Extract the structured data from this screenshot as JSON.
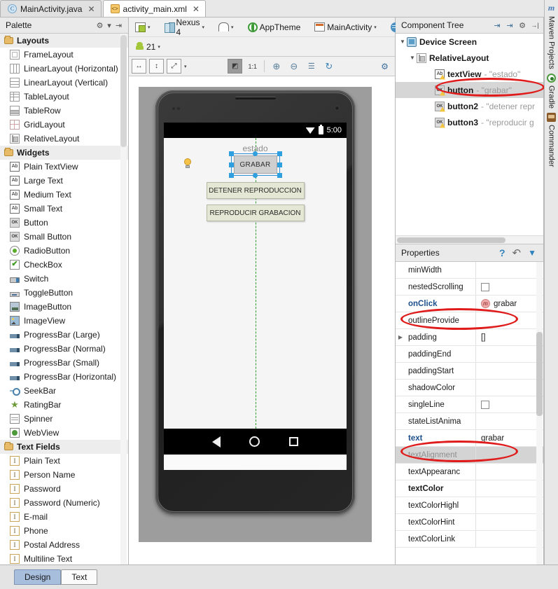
{
  "editor_tabs": [
    {
      "label": "MainActivity.java",
      "icon": "java-class-icon",
      "icon_char": "C",
      "active": false,
      "close": "✕"
    },
    {
      "label": "activity_main.xml",
      "icon": "xml-file-icon",
      "icon_char": "<>",
      "active": true,
      "close": "✕"
    }
  ],
  "palette": {
    "title": "Palette",
    "gear_icon": "⚙",
    "gear_caret": "▾",
    "collapse_icon": "⇥",
    "groups": [
      {
        "label": "Layouts",
        "items": [
          {
            "label": "FrameLayout",
            "icon": "frame-layout-icon"
          },
          {
            "label": "LinearLayout (Horizontal)",
            "icon": "linear-horizontal-icon"
          },
          {
            "label": "LinearLayout (Vertical)",
            "icon": "linear-vertical-icon"
          },
          {
            "label": "TableLayout",
            "icon": "table-layout-icon"
          },
          {
            "label": "TableRow",
            "icon": "table-row-icon"
          },
          {
            "label": "GridLayout",
            "icon": "grid-layout-icon"
          },
          {
            "label": "RelativeLayout",
            "icon": "relative-layout-icon"
          }
        ]
      },
      {
        "label": "Widgets",
        "items": [
          {
            "label": "Plain TextView",
            "icon": "textview-icon",
            "glyph": "Ab"
          },
          {
            "label": "Large Text",
            "icon": "textview-icon",
            "glyph": "Ab"
          },
          {
            "label": "Medium Text",
            "icon": "textview-icon",
            "glyph": "Ab"
          },
          {
            "label": "Small Text",
            "icon": "textview-icon",
            "glyph": "Ab"
          },
          {
            "label": "Button",
            "icon": "button-icon",
            "glyph": "OK"
          },
          {
            "label": "Small Button",
            "icon": "button-icon",
            "glyph": "OK"
          },
          {
            "label": "RadioButton",
            "icon": "radiobutton-icon"
          },
          {
            "label": "CheckBox",
            "icon": "checkbox-icon",
            "glyph": "✔"
          },
          {
            "label": "Switch",
            "icon": "switch-icon"
          },
          {
            "label": "ToggleButton",
            "icon": "togglebutton-icon"
          },
          {
            "label": "ImageButton",
            "icon": "imagebutton-icon"
          },
          {
            "label": "ImageView",
            "icon": "imageview-icon"
          },
          {
            "label": "ProgressBar (Large)",
            "icon": "progressbar-icon"
          },
          {
            "label": "ProgressBar (Normal)",
            "icon": "progressbar-icon"
          },
          {
            "label": "ProgressBar (Small)",
            "icon": "progressbar-icon"
          },
          {
            "label": "ProgressBar (Horizontal)",
            "icon": "progressbar-icon"
          },
          {
            "label": "SeekBar",
            "icon": "seekbar-icon"
          },
          {
            "label": "RatingBar",
            "icon": "ratingbar-icon",
            "glyph": "★"
          },
          {
            "label": "Spinner",
            "icon": "spinner-icon"
          },
          {
            "label": "WebView",
            "icon": "webview-icon"
          }
        ]
      },
      {
        "label": "Text Fields",
        "items": [
          {
            "label": "Plain Text",
            "icon": "textfield-icon",
            "glyph": "I"
          },
          {
            "label": "Person Name",
            "icon": "textfield-icon",
            "glyph": "I"
          },
          {
            "label": "Password",
            "icon": "textfield-icon",
            "glyph": "I"
          },
          {
            "label": "Password (Numeric)",
            "icon": "textfield-icon",
            "glyph": "I"
          },
          {
            "label": "E-mail",
            "icon": "textfield-icon",
            "glyph": "I"
          },
          {
            "label": "Phone",
            "icon": "textfield-icon",
            "glyph": "I"
          },
          {
            "label": "Postal Address",
            "icon": "textfield-icon",
            "glyph": "I"
          },
          {
            "label": "Multiline Text",
            "icon": "textfield-icon",
            "glyph": "I"
          }
        ]
      }
    ]
  },
  "design_toolbar": {
    "layout_file_icon": "layout-variant-icon",
    "device": "Nexus 4",
    "orientation_icon": "orientation-icon",
    "theme": "AppTheme",
    "activity": "MainActivity",
    "locale_icon": "locale-globe-icon",
    "api_level": "21",
    "caret": "▾",
    "row2_buttons": [
      {
        "name": "align-horizontal-icon",
        "glyph": "↔"
      },
      {
        "name": "align-vertical-icon",
        "glyph": "↕"
      },
      {
        "name": "expand-icon",
        "glyph": "⤢"
      }
    ],
    "right_buttons": [
      {
        "name": "blueprint-mode-icon",
        "glyph": "◩",
        "selected": true
      },
      {
        "name": "zoom-actual-icon",
        "glyph": "1:1"
      },
      {
        "name": "zoom-in-icon",
        "glyph": "⊕"
      },
      {
        "name": "zoom-out-icon",
        "glyph": "⊖"
      },
      {
        "name": "zoom-fit-icon",
        "glyph": "☰"
      },
      {
        "name": "refresh-icon",
        "glyph": "↻"
      },
      {
        "name": "settings-gear-icon",
        "glyph": "⚙"
      }
    ]
  },
  "device_preview": {
    "status_time": "5:00",
    "wifi_icon": "wifi-icon",
    "battery_icon": "battery-icon",
    "textview_label": "estado",
    "selected_button": "GRABAR",
    "lightbulb_icon": "lightbulb-icon",
    "buttons": [
      {
        "label": "DETENER REPRODUCCION"
      },
      {
        "label": "REPRODUCIR GRABACION"
      }
    ],
    "nav": [
      {
        "name": "nav-back-icon"
      },
      {
        "name": "nav-home-icon"
      },
      {
        "name": "nav-recents-icon"
      }
    ]
  },
  "component_tree": {
    "title": "Component Tree",
    "toolbar_icons": [
      {
        "name": "expand-all-icon",
        "glyph": "⇥"
      },
      {
        "name": "collapse-all-icon",
        "glyph": "⇥"
      },
      {
        "name": "gear-icon",
        "glyph": "⚙"
      },
      {
        "name": "hide-panel-icon",
        "glyph": "→|"
      }
    ],
    "nodes": [
      {
        "depth": 0,
        "twist": "▼",
        "icon": "device-screen-icon",
        "name": "Device Screen",
        "value": "",
        "selected": false
      },
      {
        "depth": 1,
        "twist": "▼",
        "icon": "relative-layout-icon",
        "name": "RelativeLayout",
        "value": "",
        "selected": false
      },
      {
        "depth": 2,
        "twist": "",
        "icon": "textview-icon",
        "name": "textView",
        "value": "- \"estado\"",
        "selected": false
      },
      {
        "depth": 2,
        "twist": "",
        "icon": "button-icon",
        "name": "button",
        "value": "- \"grabar\"",
        "selected": true
      },
      {
        "depth": 2,
        "twist": "",
        "icon": "button-icon",
        "name": "button2",
        "value": "- \"detener repr",
        "selected": false
      },
      {
        "depth": 2,
        "twist": "",
        "icon": "button-icon",
        "name": "button3",
        "value": "- \"reproducir g",
        "selected": false
      }
    ]
  },
  "properties": {
    "title": "Properties",
    "help_icon": "?",
    "undo_icon": "↶",
    "filter_icon": "▼",
    "rows": [
      {
        "name": "minWidth",
        "value": "",
        "type": "text",
        "style": "normal"
      },
      {
        "name": "nestedScrolling",
        "value": "",
        "type": "checkbox",
        "style": "normal"
      },
      {
        "name": "onClick",
        "value": "grabar",
        "type": "method",
        "style": "blue",
        "badge": "m",
        "highlighted": true
      },
      {
        "name": "outlineProvide",
        "value": "",
        "type": "text",
        "style": "normal"
      },
      {
        "name": "padding",
        "value": "[]",
        "type": "text",
        "style": "normal",
        "expandable": true
      },
      {
        "name": "paddingEnd",
        "value": "",
        "type": "text",
        "style": "normal"
      },
      {
        "name": "paddingStart",
        "value": "",
        "type": "text",
        "style": "normal"
      },
      {
        "name": "shadowColor",
        "value": "",
        "type": "text",
        "style": "normal"
      },
      {
        "name": "singleLine",
        "value": "",
        "type": "checkbox",
        "style": "normal"
      },
      {
        "name": "stateListAnima",
        "value": "",
        "type": "text",
        "style": "normal"
      },
      {
        "name": "text",
        "value": "grabar",
        "type": "text",
        "style": "blue",
        "highlighted": true
      },
      {
        "name": "textAlignment",
        "value": "",
        "type": "text",
        "style": "dim",
        "selected": true
      },
      {
        "name": "textAppearanc",
        "value": "",
        "type": "text",
        "style": "normal"
      },
      {
        "name": "textColor",
        "value": "",
        "type": "text",
        "style": "bold"
      },
      {
        "name": "textColorHighl",
        "value": "",
        "type": "text",
        "style": "normal"
      },
      {
        "name": "textColorHint",
        "value": "",
        "type": "text",
        "style": "normal"
      },
      {
        "name": "textColorLink",
        "value": "",
        "type": "text",
        "style": "normal"
      }
    ]
  },
  "bottom_tabs": [
    {
      "label": "Design",
      "active": true
    },
    {
      "label": "Text",
      "active": false
    }
  ],
  "right_sidebar": [
    {
      "label": "Maven Projects",
      "icon": "maven-icon",
      "glyph": "m"
    },
    {
      "label": "Gradle",
      "icon": "gradle-icon"
    },
    {
      "label": "Commander",
      "icon": "commander-icon"
    }
  ],
  "colors": {
    "accent_blue": "#2f82bd",
    "annotation_red": "#e01b1b",
    "selection_blue": "#2f9fe0",
    "android_green": "#a4c639",
    "guideline_green": "#2e9c2e"
  }
}
